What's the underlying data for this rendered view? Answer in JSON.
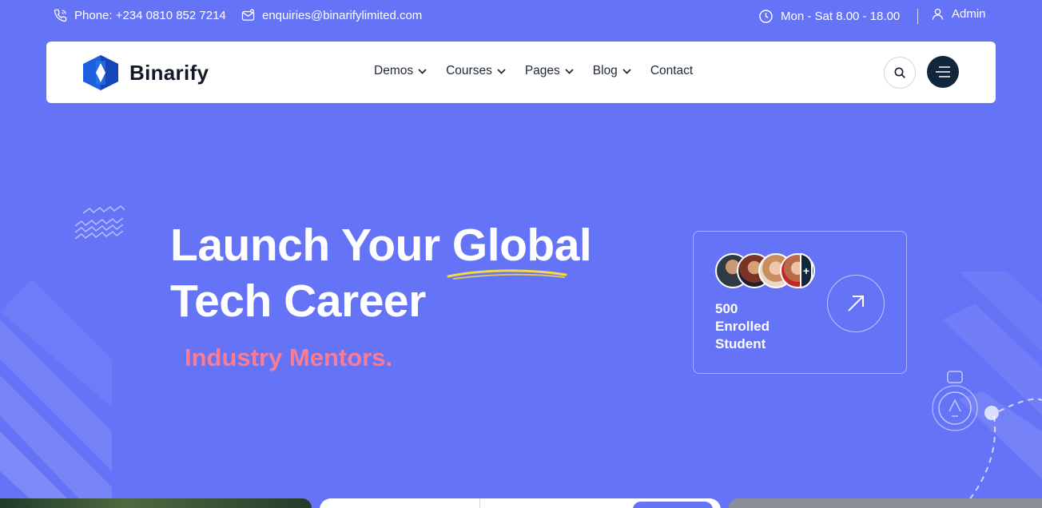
{
  "topbar": {
    "phone": "Phone: +234 0810 852 7214",
    "email": "enquiries@binarifylimited.com",
    "hours": "Mon - Sat 8.00 - 18.00",
    "admin": "Admin"
  },
  "nav": {
    "brand": "Binarify",
    "items": [
      {
        "label": "Demos",
        "dropdown": true
      },
      {
        "label": "Courses",
        "dropdown": true
      },
      {
        "label": "Pages",
        "dropdown": true
      },
      {
        "label": "Blog",
        "dropdown": true
      },
      {
        "label": "Contact",
        "dropdown": false
      }
    ],
    "search_icon": "search-icon",
    "menu_icon": "hamburger-icon"
  },
  "hero": {
    "title_line1": "Launch Your Global",
    "title_line2": "Tech Career",
    "typed_text": "Industry Mentors."
  },
  "enroll_card": {
    "count": "500",
    "label_line1": "Enrolled",
    "label_line2": "Student",
    "plus": "+",
    "arrow_icon": "arrow-up-right-icon"
  },
  "colors": {
    "background": "#6573f7",
    "accent_pink": "#f87c93",
    "dark": "#11253d",
    "highlight_yellow": "#f5d94b"
  }
}
